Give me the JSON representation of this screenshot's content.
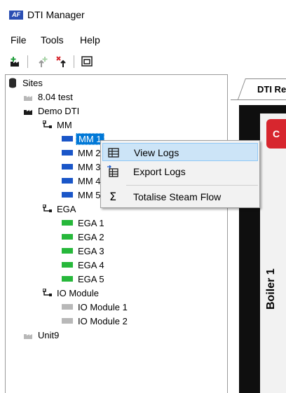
{
  "app": {
    "logo_text": "AF",
    "title": "DTI Manager"
  },
  "menu": [
    "File",
    "Tools",
    "Help"
  ],
  "toolbar": [
    "add-site-icon",
    "add-device-icon",
    "remove-device-icon",
    "window-icon"
  ],
  "tree": {
    "root": "Sites",
    "sites": [
      {
        "label": "8.04 test"
      },
      {
        "label": "Demo DTI",
        "groups": [
          {
            "label": "MM",
            "color": "#1a56c8",
            "items": [
              "MM 1",
              "MM 2",
              "MM 3",
              "MM 4",
              "MM 5"
            ],
            "selected": "MM 1"
          },
          {
            "label": "EGA",
            "color": "#27b83b",
            "items": [
              "EGA 1",
              "EGA 2",
              "EGA 3",
              "EGA 4",
              "EGA 5"
            ]
          },
          {
            "label": "IO Module",
            "color": "#b8b8b8",
            "items": [
              "IO Module 1",
              "IO Module 2"
            ]
          }
        ]
      },
      {
        "label": "Unit9"
      }
    ]
  },
  "context_menu": [
    {
      "label": "View Logs",
      "icon": "table-icon"
    },
    {
      "label": "Export Logs",
      "icon": "export-table-icon"
    },
    {
      "label": "Totalise Steam Flow",
      "icon": "sigma-icon"
    }
  ],
  "right_pane": {
    "tab_label": "DTI Re",
    "button_label": "C",
    "vertical_label": "Boiler 1"
  },
  "colors": {
    "selection": "#0078d7",
    "menu_highlight": "#cce4f7",
    "accent_red": "#d7262e"
  }
}
